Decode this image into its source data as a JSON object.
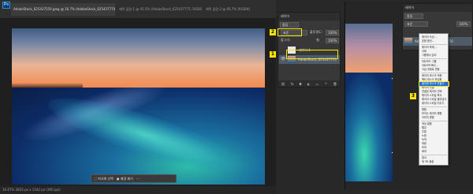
{
  "doc": {
    "tabs": [
      "AdobeStock_625437550.jpeg @ 16.7% (AdobeStock_625437770, RGB/8#) *",
      "제목 없음-1 @ 45.5% (AdobeStock_625437775, RGB/8)",
      "제목 없음-2 @ 66.7% (RGB/8)"
    ],
    "app_icon": "Ps",
    "status_text": "16.67%   3833 px x 1542 px (300 ppi)",
    "context_bar": {
      "select": "피사체 선택",
      "remove": "배경 제거",
      "more": "···"
    }
  },
  "layers": {
    "title": "레이어",
    "kind_label": "종류",
    "blend_mode": "표준",
    "opacity_label": "불투명도:",
    "opacity_value": "100%",
    "lock_label": "잠그기:",
    "fill_label": "칠:",
    "fill_value": "100%",
    "layers": [
      "레이어 1",
      "AdobeStock_625437770"
    ],
    "callouts": [
      "1",
      "2"
    ]
  },
  "win2": {
    "panel_title": "레이어",
    "kind_label": "종류",
    "blend_mode": "표준",
    "opacity_value": "100%",
    "layer_name": "AdobeStock_625437770"
  },
  "menu": {
    "items_top": [
      "레이어 속성...",
      "혼합 옵션...",
      "",
      "레이어 복제...",
      "삭제",
      "그룹에서 분리",
      "",
      "아트보드 그룹",
      "아트보드에서..."
    ],
    "items_mid": [
      "고급 개체로 변환",
      "",
      "레이어 마스크 적용",
      "벡터 마스크 활성화",
      "클리핑 마스크 만들기"
    ],
    "selected": "클리핑 마스크 만들기",
    "callout": "3",
    "items_bottom": [
      "레이어 연결",
      "연결된 레이어 선택",
      "레이어 스타일 복사",
      "레이어 스타일 붙여넣기",
      "레이어 스타일 지우기",
      "",
      "병합",
      "보이는 레이어 병합",
      "이미지 병합",
      "",
      "색상 없음",
      "빨강",
      "주황",
      "노랑",
      "녹색",
      "파랑",
      "보라",
      "회색",
      "",
      "엽서",
      "새 3D 돌출"
    ]
  },
  "colors": {
    "accent": "#ffe600",
    "menu_highlight": "#1e6fd0"
  }
}
